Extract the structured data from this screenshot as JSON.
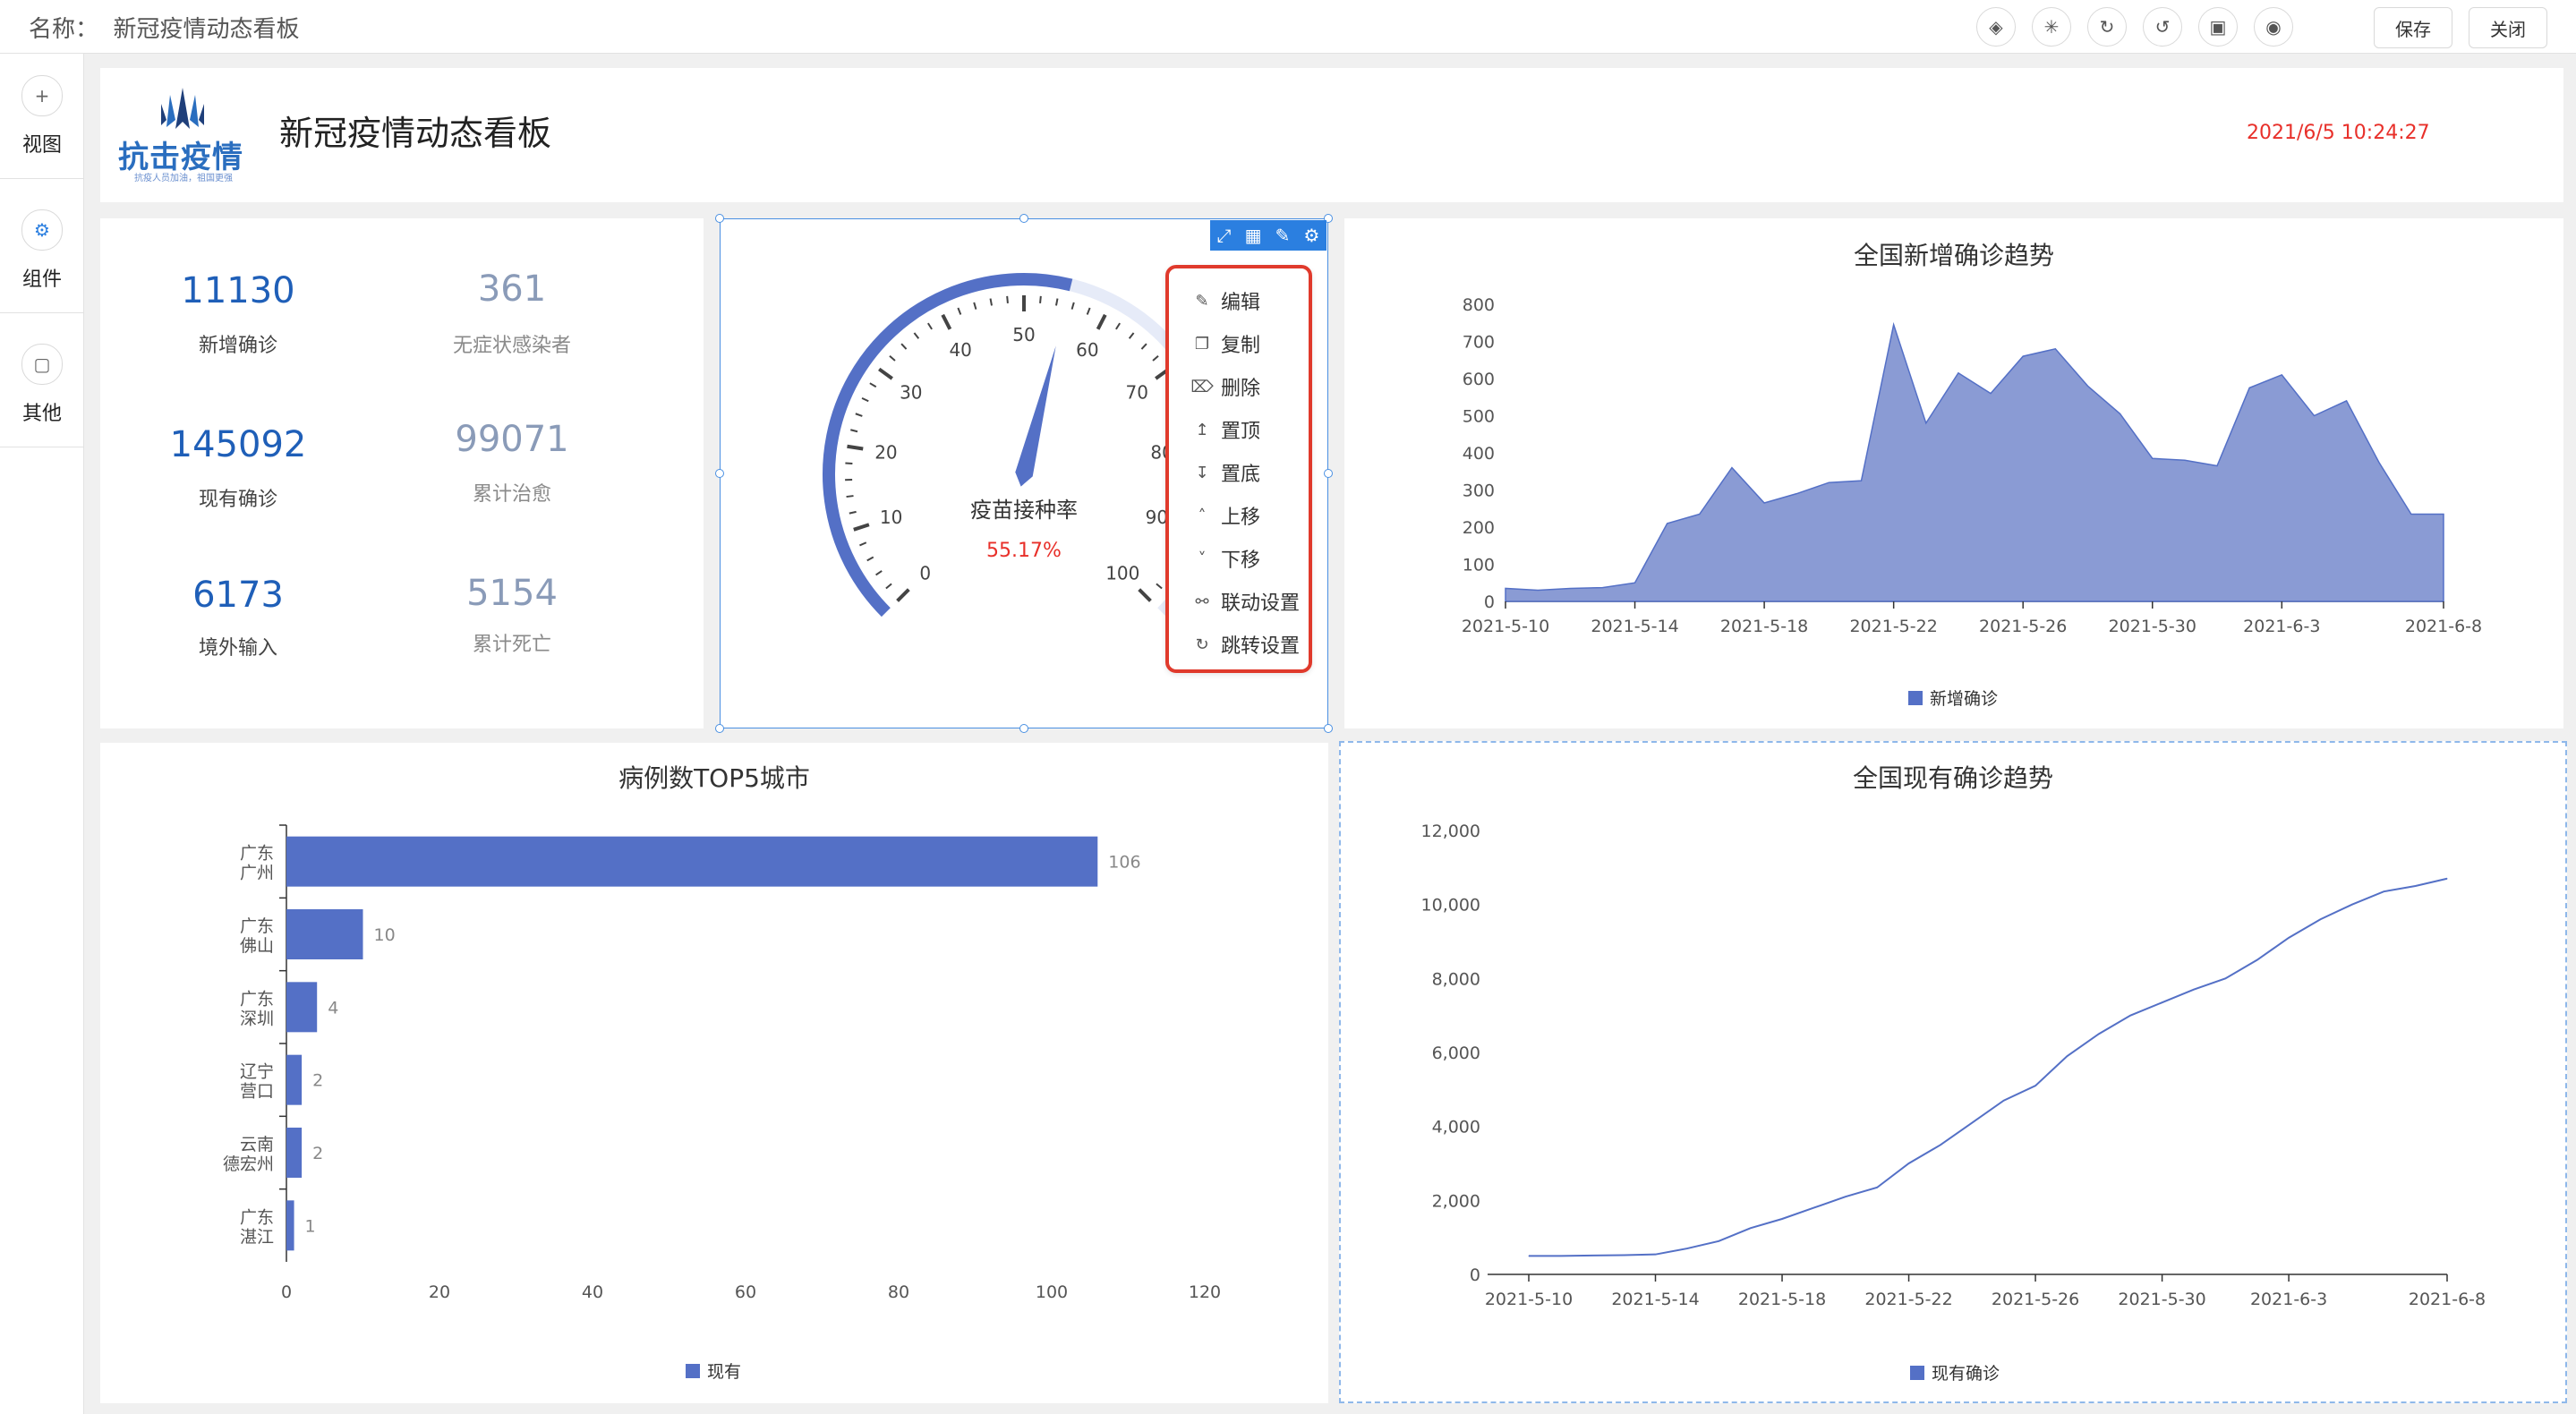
{
  "topbar": {
    "name_label": "名称：",
    "name_value": "新冠疫情动态看板",
    "icons": [
      "layers-icon",
      "magic-icon",
      "redo-icon",
      "undo-icon",
      "file-icon",
      "eye-icon"
    ],
    "save_label": "保存",
    "close_label": "关闭"
  },
  "sidebar": {
    "items": [
      {
        "label": "视图",
        "icon": "plus-circle-icon"
      },
      {
        "label": "组件",
        "icon": "gear-icon"
      },
      {
        "label": "其他",
        "icon": "box-icon"
      }
    ]
  },
  "header": {
    "logo_text": "抗击疫情",
    "logo_sub": "抗疫人员加油，祖国更强",
    "title": "新冠疫情动态看板",
    "datetime": "2021/6/5 10:24:27"
  },
  "stats": [
    {
      "value": "11130",
      "label": "新增确诊"
    },
    {
      "value": "361",
      "label": "无症状感染者"
    },
    {
      "value": "145092",
      "label": "现有确诊"
    },
    {
      "value": "99071",
      "label": "累计治愈"
    },
    {
      "value": "6173",
      "label": "境外输入"
    },
    {
      "value": "5154",
      "label": "累计死亡"
    }
  ],
  "gauge": {
    "title": "疫苗接种率",
    "value_text": "55.17%",
    "value": 55.17,
    "ticks": [
      "0",
      "10",
      "20",
      "30",
      "40",
      "50",
      "60",
      "70",
      "80",
      "90",
      "100"
    ],
    "accent": "#5470c6",
    "value_color": "#e8302a"
  },
  "context_menu": [
    {
      "label": "编辑",
      "icon": "edit-icon"
    },
    {
      "label": "复制",
      "icon": "copy-icon"
    },
    {
      "label": "删除",
      "icon": "trash-icon"
    },
    {
      "label": "置顶",
      "icon": "to-top-icon"
    },
    {
      "label": "置底",
      "icon": "to-bottom-icon"
    },
    {
      "label": "上移",
      "icon": "chevron-up-icon"
    },
    {
      "label": "下移",
      "icon": "chevron-down-icon"
    },
    {
      "label": "联动设置",
      "icon": "link-icon"
    },
    {
      "label": "跳转设置",
      "icon": "jump-icon"
    }
  ],
  "chart_data": [
    {
      "type": "area",
      "title": "全国新增确诊趋势",
      "x": [
        "2021-5-10",
        "2021-5-11",
        "2021-5-12",
        "2021-5-13",
        "2021-5-14",
        "2021-5-15",
        "2021-5-16",
        "2021-5-17",
        "2021-5-18",
        "2021-5-19",
        "2021-5-20",
        "2021-5-21",
        "2021-5-22",
        "2021-5-23",
        "2021-5-24",
        "2021-5-25",
        "2021-5-26",
        "2021-5-27",
        "2021-5-28",
        "2021-5-29",
        "2021-5-30",
        "2021-5-31",
        "2021-6-1",
        "2021-6-2",
        "2021-6-3",
        "2021-6-4",
        "2021-6-5",
        "2021-6-6",
        "2021-6-7",
        "2021-6-8"
      ],
      "x_tick_labels": [
        "2021-5-10",
        "2021-5-14",
        "2021-5-18",
        "2021-5-22",
        "2021-5-26",
        "2021-5-30",
        "2021-6-3",
        "2021-6-8"
      ],
      "series": [
        {
          "name": "新增确诊",
          "values": [
            35,
            30,
            35,
            37,
            50,
            210,
            235,
            360,
            265,
            290,
            320,
            325,
            745,
            480,
            615,
            560,
            660,
            680,
            580,
            505,
            385,
            380,
            365,
            575,
            610,
            500,
            540,
            375,
            235,
            235
          ]
        }
      ],
      "ylim": [
        0,
        800
      ],
      "y_ticks": [
        "0",
        "100",
        "200",
        "300",
        "400",
        "500",
        "600",
        "700",
        "800"
      ],
      "legend": "bottom",
      "color": "#5470c6"
    },
    {
      "type": "bar",
      "orientation": "horizontal",
      "title": "病例数TOP5城市",
      "categories": [
        [
          "广东",
          "广州"
        ],
        [
          "广东",
          "佛山"
        ],
        [
          "广东",
          "深圳"
        ],
        [
          "辽宁",
          "营口"
        ],
        [
          "云南",
          "德宏州"
        ],
        [
          "广东",
          "湛江"
        ]
      ],
      "series": [
        {
          "name": "现有",
          "values": [
            106,
            10,
            4,
            2,
            2,
            1
          ]
        }
      ],
      "xlim": [
        0,
        120
      ],
      "x_ticks": [
        "0",
        "20",
        "40",
        "60",
        "80",
        "100",
        "120"
      ],
      "legend": "bottom",
      "color": "#5470c6"
    },
    {
      "type": "line",
      "title": "全国现有确诊趋势",
      "x": [
        "2021-5-10",
        "2021-5-11",
        "2021-5-12",
        "2021-5-13",
        "2021-5-14",
        "2021-5-15",
        "2021-5-16",
        "2021-5-17",
        "2021-5-18",
        "2021-5-19",
        "2021-5-20",
        "2021-5-21",
        "2021-5-22",
        "2021-5-23",
        "2021-5-24",
        "2021-5-25",
        "2021-5-26",
        "2021-5-27",
        "2021-5-28",
        "2021-5-29",
        "2021-5-30",
        "2021-5-31",
        "2021-6-1",
        "2021-6-2",
        "2021-6-3",
        "2021-6-4",
        "2021-6-5",
        "2021-6-6",
        "2021-6-7",
        "2021-6-8"
      ],
      "x_tick_labels": [
        "2021-5-10",
        "2021-5-14",
        "2021-5-18",
        "2021-5-22",
        "2021-5-26",
        "2021-5-30",
        "2021-6-3",
        "2021-6-8"
      ],
      "series": [
        {
          "name": "现有确诊",
          "values": [
            500,
            500,
            510,
            520,
            540,
            700,
            900,
            1250,
            1500,
            1800,
            2100,
            2350,
            3000,
            3500,
            4100,
            4700,
            5100,
            5900,
            6500,
            7000,
            7350,
            7700,
            8000,
            8500,
            9100,
            9600,
            10000,
            10350,
            10500,
            10700
          ]
        }
      ],
      "ylim": [
        0,
        12000
      ],
      "y_ticks": [
        "0",
        "2,000",
        "4,000",
        "6,000",
        "8,000",
        "10,000",
        "12,000"
      ],
      "legend": "bottom",
      "color": "#5470c6"
    }
  ]
}
